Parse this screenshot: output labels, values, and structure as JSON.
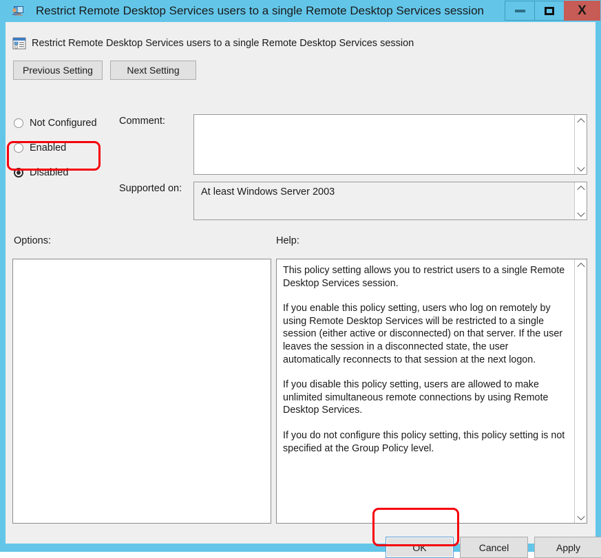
{
  "window": {
    "title": "Restrict Remote Desktop Services users to a single Remote Desktop Services session",
    "title_icon": "remote-desktop-icon",
    "controls": {
      "minimize": "minimize-icon",
      "maximize": "maximize-icon",
      "close": "X"
    },
    "accent_color": "#63C6E9",
    "close_color": "#C75B55"
  },
  "header": {
    "policy_icon": "group-policy-setting-icon",
    "policy_name": "Restrict Remote Desktop Services users to a single Remote Desktop Services session"
  },
  "nav": {
    "previous_label": "Previous Setting",
    "next_label": "Next Setting"
  },
  "state_options": {
    "items": [
      {
        "label": "Not Configured",
        "selected": false
      },
      {
        "label": "Enabled",
        "selected": false
      },
      {
        "label": "Disabled",
        "selected": true
      }
    ]
  },
  "comment": {
    "label": "Comment:",
    "value": "",
    "scroll_up_icon": "chevron-up-icon",
    "scroll_down_icon": "chevron-down-icon"
  },
  "supported_on": {
    "label": "Supported on:",
    "value": "At least Windows Server 2003",
    "scroll_up_icon": "chevron-up-icon",
    "scroll_down_icon": "chevron-down-icon"
  },
  "options_panel": {
    "label": "Options:",
    "content": ""
  },
  "help_panel": {
    "label": "Help:",
    "paragraphs": [
      "This policy setting allows you to restrict users to a single Remote Desktop Services session.",
      "If you enable this policy setting, users who log on remotely by using Remote Desktop Services will be restricted to a single session (either active or disconnected) on that server. If the user leaves the session in a disconnected state, the user automatically reconnects to that session at the next logon.",
      "If you disable this policy setting, users are allowed to make unlimited simultaneous remote connections by using Remote Desktop Services.",
      "If you do not configure this policy setting,  this policy setting is not specified at the Group Policy level."
    ],
    "scroll_up_icon": "chevron-up-icon",
    "scroll_down_icon": "chevron-down-icon"
  },
  "footer": {
    "ok_label": "OK",
    "cancel_label": "Cancel",
    "apply_label": "Apply"
  },
  "annotations": {
    "highlight_color": "#F5000B",
    "highlighted_elements": [
      "Disabled",
      "OK"
    ]
  }
}
